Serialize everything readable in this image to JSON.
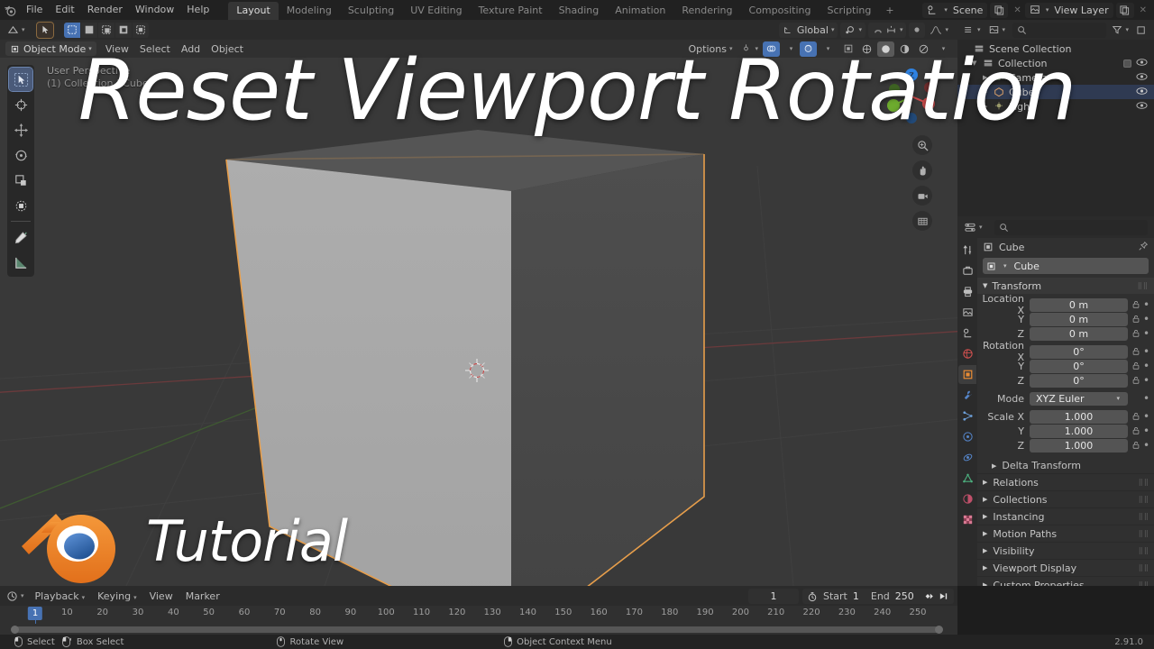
{
  "app": {
    "version": "2.91.0",
    "logo_name": "blender-logo"
  },
  "overlay": {
    "title": "Reset Viewport Rotation",
    "brand_word": "Tutorial"
  },
  "topbar": {
    "menus": [
      "File",
      "Edit",
      "Render",
      "Window",
      "Help"
    ],
    "workspaces": [
      {
        "label": "Layout",
        "active": true
      },
      {
        "label": "Modeling",
        "active": false
      },
      {
        "label": "Sculpting",
        "active": false
      },
      {
        "label": "UV Editing",
        "active": false
      },
      {
        "label": "Texture Paint",
        "active": false
      },
      {
        "label": "Shading",
        "active": false
      },
      {
        "label": "Animation",
        "active": false
      },
      {
        "label": "Rendering",
        "active": false
      },
      {
        "label": "Compositing",
        "active": false
      },
      {
        "label": "Scripting",
        "active": false
      }
    ],
    "add_workspace": "+",
    "scene_label": "Scene",
    "view_layer_label": "View Layer",
    "scene_icon": "scene-icon",
    "view_layer_icon": "view-layer-icon",
    "new_scene_icon": "copy-icon",
    "remove_icon": "x-icon"
  },
  "viewport_header": {
    "editor_type_icon": "editor-type-icon",
    "cursor_tool_icon": "select-box-icon",
    "select_modes": [
      "select-set",
      "select-extend",
      "select-subtract",
      "select-invert",
      "select-intersect"
    ],
    "transform_orientation": "Global",
    "orientation_icon": "orientation-icon",
    "snap_icon": "snap-magnet-icon",
    "pivot_icon": "pivot-icon",
    "proportional_icon": "proportional-edit-icon",
    "show_gizmo_icon": "gizmo-icon",
    "show_overlays_icon": "overlays-icon",
    "xray_icon": "xray-icon",
    "shading_modes": [
      "wireframe",
      "solid",
      "material-preview",
      "rendered"
    ],
    "active_shading": "solid"
  },
  "viewport_subheader": {
    "mode": "Object Mode",
    "mode_icon": "object-mode-icon",
    "menus": [
      "View",
      "Select",
      "Add",
      "Object"
    ],
    "options_label": "Options"
  },
  "viewport": {
    "info_line1": "User Perspective",
    "info_line2": "(1) Collection | Cube",
    "background_color": "#393939",
    "selected_outline_color": "#e79e4b",
    "cube_face_front": "#a8a8a8",
    "cube_face_right": "#4a4a4a",
    "cube_face_top": "#5e5e5e",
    "tools": [
      {
        "name": "tweak-select-tool",
        "active": true
      },
      {
        "name": "cursor-tool",
        "active": false
      },
      {
        "name": "move-tool",
        "active": false
      },
      {
        "name": "rotate-tool",
        "active": false
      },
      {
        "name": "scale-tool",
        "active": false
      },
      {
        "name": "transform-tool",
        "active": false
      },
      {
        "name": "annotate-tool",
        "active": false
      },
      {
        "name": "measure-tool",
        "active": false
      }
    ],
    "nav_buttons": [
      {
        "name": "zoom-view-icon"
      },
      {
        "name": "move-view-hand-icon"
      },
      {
        "name": "camera-view-icon"
      },
      {
        "name": "toggle-perspective-icon"
      }
    ],
    "gizmo_axes": [
      {
        "label": "Z",
        "color": "#2f83e3"
      },
      {
        "label": "Y",
        "color": "#6dab2e"
      },
      {
        "label": "X",
        "color": "#cd4b4b"
      }
    ]
  },
  "outliner": {
    "display_mode_icon": "outliner-display-icon",
    "filter_icon": "filter-icon",
    "search_icon": "search-icon",
    "search_placeholder": "",
    "rows": [
      {
        "name": "Scene Collection",
        "icon": "collection-icon",
        "indent": 0,
        "selected": false,
        "has_tri": false,
        "checkbox": false,
        "eye": false
      },
      {
        "name": "Collection",
        "icon": "collection-icon",
        "indent": 1,
        "selected": false,
        "has_tri": true,
        "checkbox": true,
        "eye": true
      },
      {
        "name": "Camera",
        "icon": "camera-data-icon",
        "indent": 2,
        "selected": false,
        "has_tri": true,
        "checkbox": false,
        "eye": true
      },
      {
        "name": "Cube",
        "icon": "mesh-data-icon",
        "indent": 2,
        "selected": true,
        "has_tri": true,
        "checkbox": false,
        "eye": true
      },
      {
        "name": "Light",
        "icon": "light-data-icon",
        "indent": 2,
        "selected": false,
        "has_tri": true,
        "checkbox": false,
        "eye": true
      }
    ]
  },
  "properties": {
    "editor_icon": "properties-editor-icon",
    "search_placeholder": "",
    "tabs": [
      {
        "name": "tool-tab",
        "active": false,
        "color": "#bdbdbd"
      },
      {
        "name": "render-tab",
        "active": false,
        "color": "#bdbdbd"
      },
      {
        "name": "output-tab",
        "active": false,
        "color": "#bdbdbd"
      },
      {
        "name": "view-layer-tab",
        "active": false,
        "color": "#bdbdbd"
      },
      {
        "name": "scene-tab",
        "active": false,
        "color": "#bdbdbd"
      },
      {
        "name": "world-tab",
        "active": false,
        "color": "#d1504f"
      },
      {
        "name": "object-tab",
        "active": true,
        "color": "#e88b34"
      },
      {
        "name": "modifiers-tab",
        "active": false,
        "color": "#5585c9"
      },
      {
        "name": "particles-tab",
        "active": false,
        "color": "#6d9fd8"
      },
      {
        "name": "physics-tab",
        "active": false,
        "color": "#5585c9"
      },
      {
        "name": "constraints-tab",
        "active": false,
        "color": "#5585c9"
      },
      {
        "name": "object-data-tab",
        "active": false,
        "color": "#4caf7e"
      },
      {
        "name": "material-tab",
        "active": false,
        "color": "#c0506a"
      },
      {
        "name": "texture-tab",
        "active": false,
        "color": "#c0506a"
      }
    ],
    "breadcrumb_object": "Cube",
    "object_name": "Cube",
    "pin_icon": "pin-icon",
    "transform_panel": "Transform",
    "fields": [
      {
        "label": "Location X",
        "value": "0 m"
      },
      {
        "label": "Y",
        "value": "0 m"
      },
      {
        "label": "Z",
        "value": "0 m"
      },
      {
        "label": "Rotation X",
        "value": "0°"
      },
      {
        "label": "Y",
        "value": "0°"
      },
      {
        "label": "Z",
        "value": "0°"
      }
    ],
    "mode_label": "Mode",
    "mode_value": "XYZ Euler",
    "scale_fields": [
      {
        "label": "Scale X",
        "value": "1.000"
      },
      {
        "label": "Y",
        "value": "1.000"
      },
      {
        "label": "Z",
        "value": "1.000"
      }
    ],
    "delta_transform": "Delta Transform",
    "closed_panels": [
      "Relations",
      "Collections",
      "Instancing",
      "Motion Paths",
      "Visibility",
      "Viewport Display",
      "Custom Properties"
    ]
  },
  "timeline": {
    "editor_icon": "timeline-editor-icon",
    "menus": [
      "Playback",
      "Keying",
      "View",
      "Marker"
    ],
    "record_icon": "auto-keying-icon",
    "playback_buttons": [
      "jump-to-start",
      "jump-to-keyframe-prev",
      "play-reverse",
      "play",
      "jump-to-keyframe-next",
      "jump-to-end"
    ],
    "current_frame": "1",
    "timer_icon": "timer-icon",
    "start_label": "Start",
    "start_value": "1",
    "end_label": "End",
    "end_value": "250",
    "ticks": [
      10,
      20,
      30,
      40,
      50,
      60,
      70,
      80,
      90,
      100,
      110,
      120,
      130,
      140,
      150,
      160,
      170,
      180,
      190,
      200,
      210,
      220,
      230,
      240,
      250
    ],
    "playhead_label": "1"
  },
  "statusbar": {
    "items": [
      {
        "icon": "mouse-left-icon",
        "label": "Select"
      },
      {
        "icon": "mouse-left-drag-icon",
        "label": "Box Select"
      },
      {
        "icon": "mouse-middle-icon",
        "label": "Rotate View"
      },
      {
        "icon": "mouse-right-icon",
        "label": "Object Context Menu"
      }
    ],
    "version": "2.91.0"
  }
}
